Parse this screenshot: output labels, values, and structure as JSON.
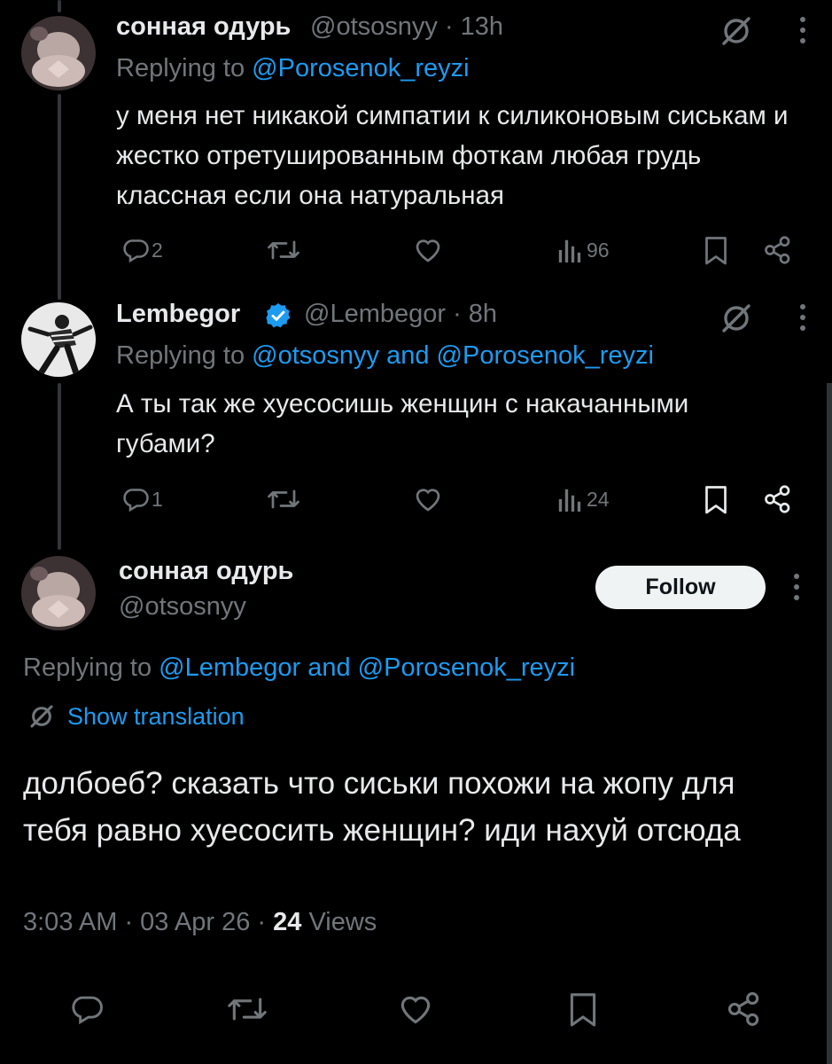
{
  "tweets": [
    {
      "name": "сонная одурь",
      "handle": "@otsosnyy",
      "time": "· 13h",
      "replying_prefix": "Replying to",
      "replying_to": "@Porosenok_reyzi",
      "text": "у меня нет никакой симпатии к силиконовым сиськам и жестко отретушированным фоткам любая грудь классная если она натуральная",
      "replies": "2",
      "views": "96"
    },
    {
      "name": "Lembegor",
      "verified": true,
      "handle": "@Lembegor",
      "time": "· 8h",
      "replying_prefix": "Replying to",
      "replying_to": "@otsosnyy and @Porosenok_reyzi",
      "text": "А ты так же хуесосишь женщин с накачанными губами?",
      "replies": "1",
      "views": "24"
    }
  ],
  "main": {
    "name": "сонная одурь",
    "handle": "@otsosnyy",
    "follow_label": "Follow",
    "replying_prefix": "Replying to",
    "replying_to": "@Lembegor and @Porosenok_reyzi",
    "show_translation": "Show translation",
    "text": "долбоеб? сказать что сиськи похожи на жопу для тебя равно хуесосить женщин? иди нахуй отсюда",
    "timestamp": "3:03 AM · 03 Apr 26 ·",
    "views_count": "24",
    "views_label": "Views"
  },
  "colors": {
    "background": "#000000",
    "text": "#e7e9ea",
    "muted": "#71767b",
    "link": "#1d9bf0",
    "verified": "#1d9bf0"
  },
  "icons": [
    "grok-icon",
    "more-icon",
    "reply-icon",
    "retweet-icon",
    "like-icon",
    "views-icon",
    "bookmark-icon",
    "share-icon",
    "translate-icon",
    "verified-badge-icon"
  ]
}
